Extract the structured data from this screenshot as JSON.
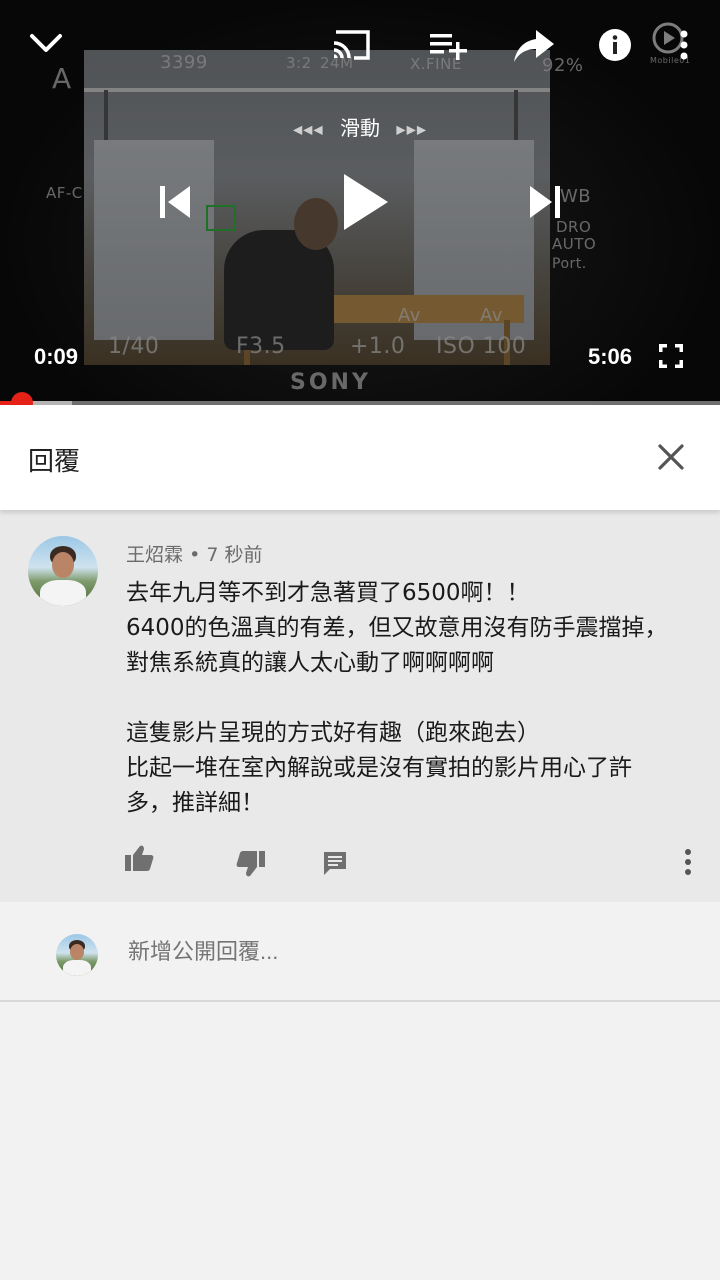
{
  "player": {
    "current_time": "0:09",
    "duration": "5:06",
    "seek_hint": "滑動",
    "seek_arrows_left": "◀◀◀",
    "seek_arrows_right": "▶▶▶",
    "progress_fraction": 0.031,
    "buffered_fraction": 0.1,
    "icons": [
      "collapse-chevron-icon",
      "cast-icon",
      "add-to-playlist-icon",
      "share-icon",
      "info-icon",
      "more-vert-icon",
      "previous-icon",
      "play-icon",
      "next-icon",
      "fullscreen-icon"
    ],
    "accent_color": "#e62117",
    "camera_display": {
      "shots": "3399",
      "aspect": "3:2",
      "size": "24M",
      "quality": "X.FINE",
      "battery": "92%",
      "mode": "A",
      "af": "AF-C",
      "wb": "WB",
      "dro": "DRO",
      "dro_mode": "AUTO",
      "port": "Port.",
      "shutter": "1/40",
      "aperture": "F3.5",
      "exposure": "+1.0",
      "iso": "ISO 100",
      "brand": "SONY",
      "av": "Av",
      "watermark": "Mobile01"
    }
  },
  "reply_panel": {
    "title": "回覆",
    "close_icon": "close-icon"
  },
  "comment": {
    "author": "王炤霖",
    "separator": "•",
    "time": "7 秒前",
    "lines": [
      "去年九月等不到才急著買了6500啊！！",
      "6400的色溫真的有差，但又故意用沒有防手震擋掉，",
      "對焦系統真的讓人太心動了啊啊啊啊",
      "",
      "這隻影片呈現的方式好有趣（跑來跑去）",
      "比起一堆在室內解說或是沒有實拍的影片用心了許",
      "多，推詳細！"
    ],
    "actions": [
      "thumb-up-icon",
      "thumb-down-icon",
      "reply-icon",
      "more-vert-icon"
    ]
  },
  "add_reply": {
    "placeholder": "新增公開回覆..."
  },
  "colors": {
    "comment_bg": "#e9e9e9",
    "page_bg": "#f2f2f2",
    "text_primary": "#1a1a1a",
    "text_secondary": "#6b6b6b",
    "icon_gray": "#707070"
  }
}
